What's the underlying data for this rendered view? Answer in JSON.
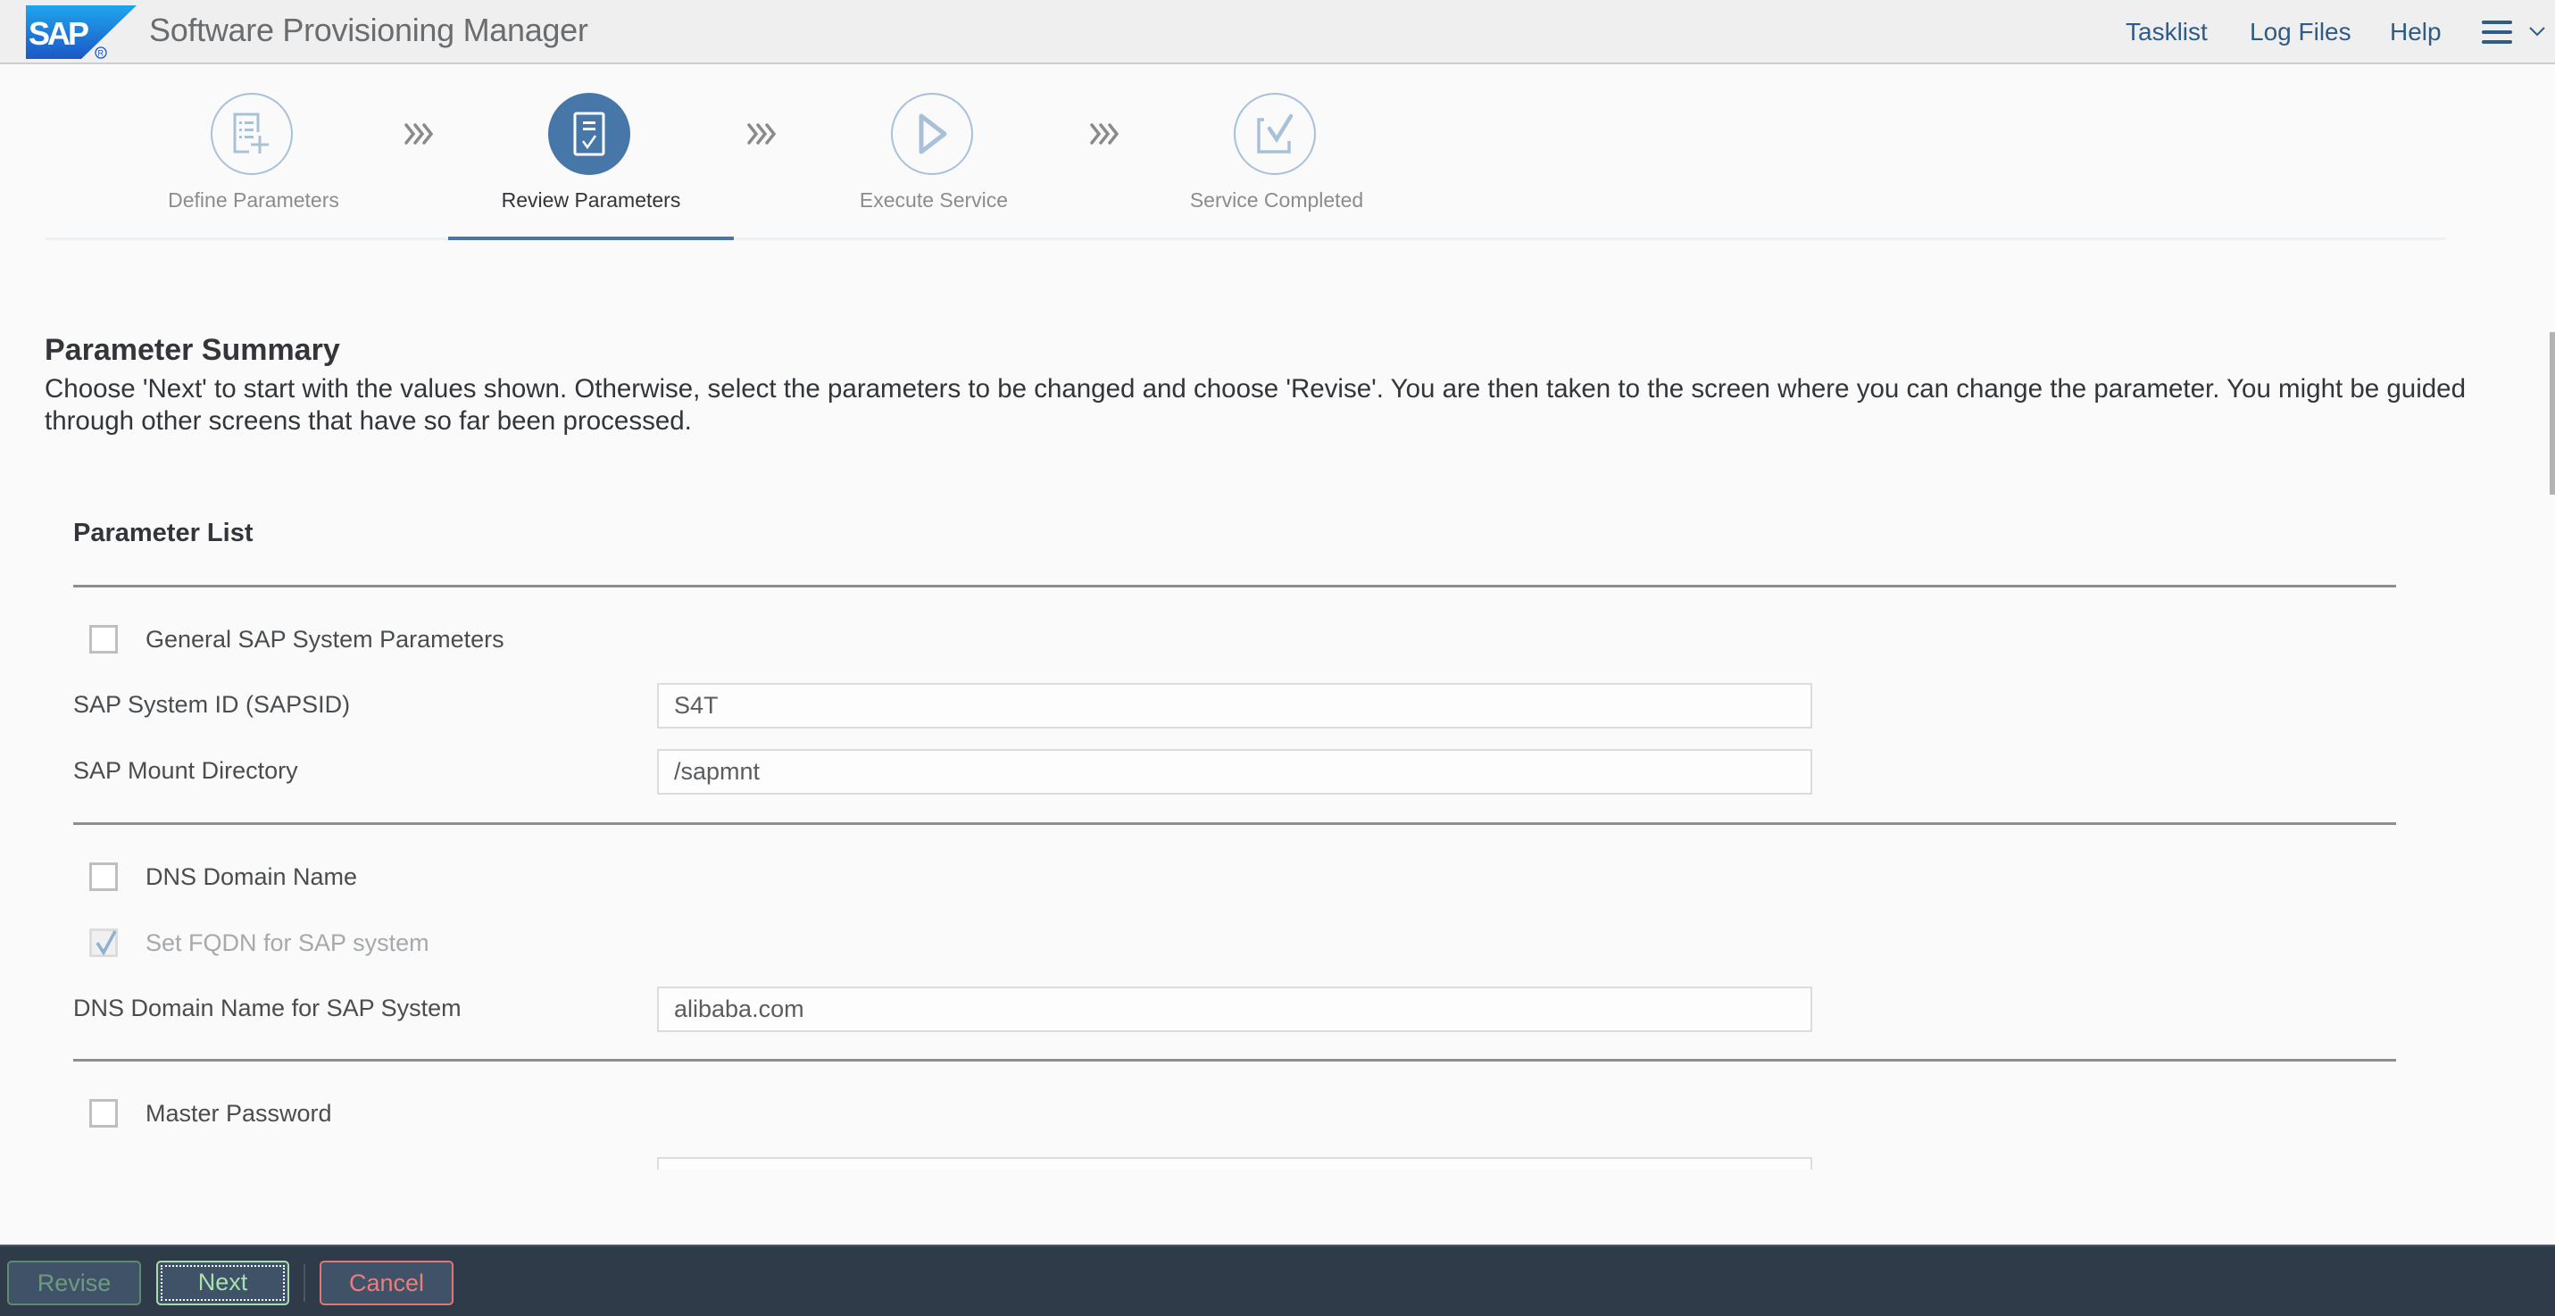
{
  "header": {
    "logo_text": "SAP",
    "title": "Software Provisioning Manager",
    "links": [
      {
        "label": "Tasklist"
      },
      {
        "label": "Log Files"
      },
      {
        "label": "Help"
      }
    ],
    "menu_icon": "hamburger-menu-icon",
    "menu_chevron": "chevron-down-icon"
  },
  "stepper": {
    "steps": [
      {
        "label": "Define Parameters",
        "icon": "define-parameters-icon",
        "state": "done"
      },
      {
        "label": "Review Parameters",
        "icon": "review-parameters-icon",
        "state": "active"
      },
      {
        "label": "Execute Service",
        "icon": "play-icon",
        "state": "pending"
      },
      {
        "label": "Service Completed",
        "icon": "check-box-icon",
        "state": "pending"
      }
    ],
    "separator_icon": "triple-chevron-right-icon"
  },
  "summary": {
    "title": "Parameter Summary",
    "description": "Choose 'Next' to start with the values shown. Otherwise, select the parameters to be changed and choose 'Revise'. You are then taken to the screen where you can change the parameter. You might be guided through other screens that have so far been processed."
  },
  "parameter_list": {
    "title": "Parameter List",
    "groups": [
      {
        "label": "General SAP System Parameters",
        "checked": false,
        "fields": [
          {
            "label": "SAP System ID (SAPSID)",
            "value": "S4T"
          },
          {
            "label": "SAP Mount Directory",
            "value": "/sapmnt"
          }
        ]
      },
      {
        "label": "DNS Domain Name",
        "checked": false,
        "sub_option": {
          "label": "Set FQDN for SAP system",
          "checked": true,
          "disabled": true
        },
        "fields": [
          {
            "label": "DNS Domain Name for SAP System",
            "value": "alibaba.com"
          }
        ]
      },
      {
        "label": "Master Password",
        "checked": false,
        "fields": [
          {
            "label": "",
            "value": ""
          }
        ]
      }
    ]
  },
  "footer": {
    "revise_label": "Revise",
    "next_label": "Next",
    "cancel_label": "Cancel"
  },
  "colors": {
    "accent": "#4677a8",
    "link": "#2f5b87",
    "footer_bg": "#2f3b48",
    "next_green": "#a8e0ae",
    "cancel_red": "#ec7d7d"
  }
}
